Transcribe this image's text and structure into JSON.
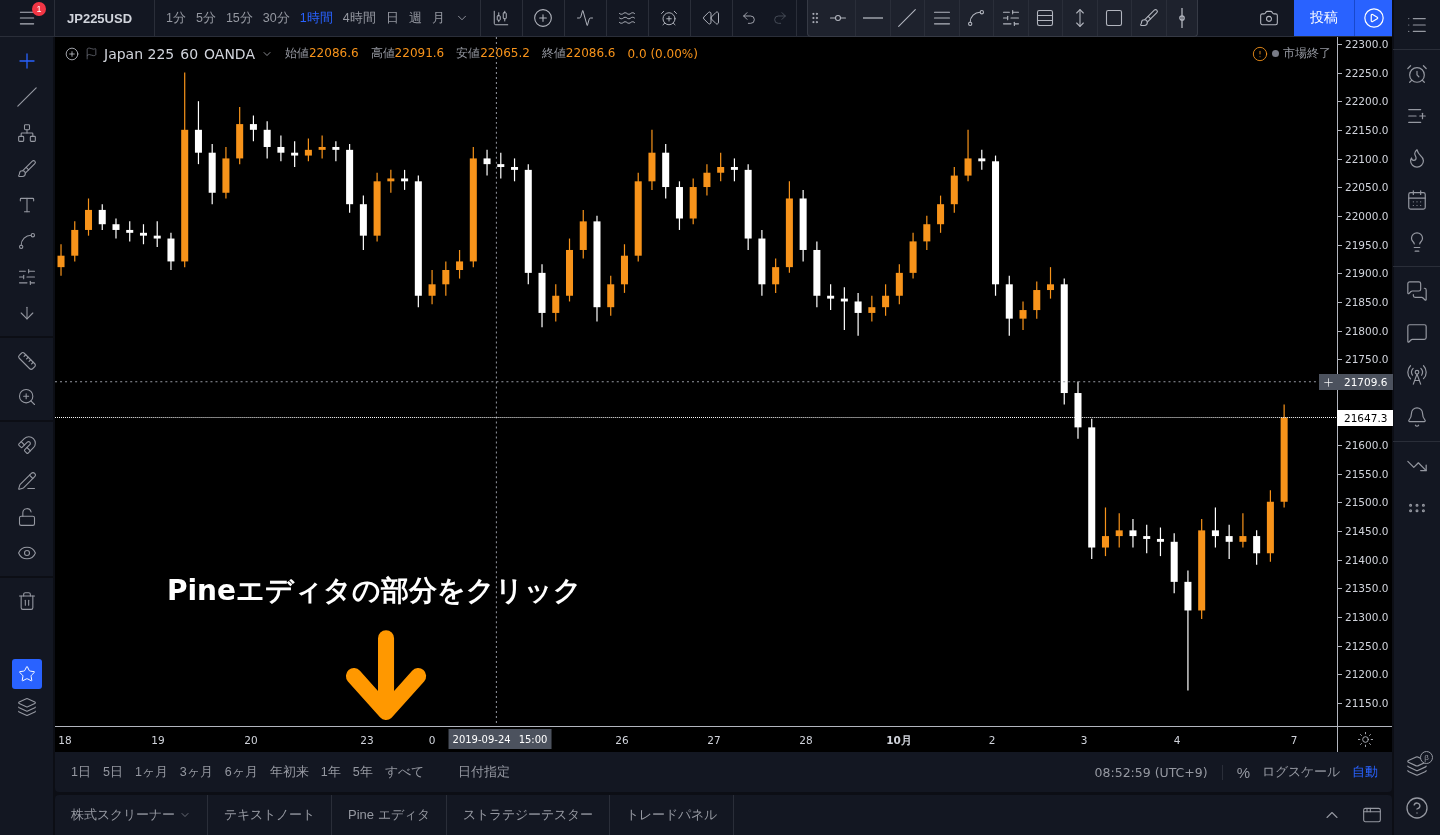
{
  "header": {
    "menu_badge": "1",
    "symbol": "JP225USD",
    "intervals": [
      {
        "label": "1分",
        "selected": false
      },
      {
        "label": "5分",
        "selected": false
      },
      {
        "label": "15分",
        "selected": false
      },
      {
        "label": "30分",
        "selected": false
      },
      {
        "label": "1時間",
        "selected": true
      },
      {
        "label": "4時間",
        "selected": false
      },
      {
        "label": "日",
        "selected": false
      },
      {
        "label": "週",
        "selected": false
      },
      {
        "label": "月",
        "selected": false
      }
    ],
    "publish_button": "投稿"
  },
  "legend": {
    "title": "Japan 225",
    "interval": "60",
    "source": "OANDA",
    "values": [
      {
        "label": "始値",
        "value": "22086.6"
      },
      {
        "label": "高値",
        "value": "22091.6"
      },
      {
        "label": "安値",
        "value": "22065.2"
      },
      {
        "label": "終値",
        "value": "22086.6"
      }
    ],
    "change": "0.0 (0.00%)",
    "market_status": "市場終了"
  },
  "price_axis": {
    "crosshair_price": "21709.6"
  },
  "time_axis": {
    "ticks": [
      {
        "label": "18",
        "kind": "day"
      },
      {
        "label": "19",
        "kind": "day"
      },
      {
        "label": "20",
        "kind": "day"
      },
      {
        "label": "23",
        "kind": "day"
      },
      {
        "label": "0",
        "kind": "day"
      },
      {
        "label": "26",
        "kind": "day"
      },
      {
        "label": "27",
        "kind": "day"
      },
      {
        "label": "28",
        "kind": "day"
      },
      {
        "label": "10月",
        "kind": "month"
      },
      {
        "label": "2",
        "kind": "day"
      },
      {
        "label": "3",
        "kind": "day"
      },
      {
        "label": "4",
        "kind": "day"
      },
      {
        "label": "7",
        "kind": "day"
      }
    ],
    "crosshair_date": "2019-09-24",
    "crosshair_time": "15:00"
  },
  "annotation": "Pineエディタの部分をクリック",
  "chart_data": {
    "type": "candlestick",
    "ylim": [
      21108.1,
      22312.2
    ],
    "ref_lines": [
      {
        "axis": "y",
        "value": 21647.3,
        "label": "21647.3"
      }
    ],
    "categories": [
      null,
      null,
      null,
      null,
      null,
      null,
      null,
      null,
      null,
      null,
      null,
      null,
      null,
      null,
      null,
      null,
      null,
      null,
      null,
      null,
      null,
      null,
      null,
      null,
      null,
      null,
      null,
      null,
      null,
      null,
      null,
      null,
      null,
      null,
      null,
      null,
      null,
      null,
      null,
      null,
      null,
      null,
      null,
      null,
      null,
      null,
      null,
      null,
      null,
      null,
      null,
      null,
      null,
      null,
      null,
      null,
      null,
      null,
      null,
      null,
      null,
      null,
      null,
      null,
      null,
      null,
      null,
      null,
      null,
      null,
      null,
      null,
      null,
      null,
      null,
      null,
      null,
      null,
      null,
      null,
      null,
      null,
      null,
      null,
      null,
      null,
      null,
      null,
      null,
      null
    ],
    "yticks": [
      {
        "value": 22300,
        "label": "22300.0"
      },
      {
        "value": 22250,
        "label": "22250.0"
      },
      {
        "value": 22200,
        "label": "22200.0"
      },
      {
        "value": 22150,
        "label": "22150.0"
      },
      {
        "value": 22100,
        "label": "22100.0"
      },
      {
        "value": 22050,
        "label": "22050.0"
      },
      {
        "value": 22000,
        "label": "22000.0"
      },
      {
        "value": 21950,
        "label": "21950.0"
      },
      {
        "value": 21900,
        "label": "21900.0"
      },
      {
        "value": 21850,
        "label": "21850.0"
      },
      {
        "value": 21800,
        "label": "21800.0"
      },
      {
        "value": 21750,
        "label": "21750.0"
      },
      {
        "value": 21600,
        "label": "21600.0"
      },
      {
        "value": 21550,
        "label": "21550.0"
      },
      {
        "value": 21500,
        "label": "21500.0"
      },
      {
        "value": 21450,
        "label": "21450.0"
      },
      {
        "value": 21400,
        "label": "21400.0"
      },
      {
        "value": 21350,
        "label": "21350.0"
      },
      {
        "value": 21300,
        "label": "21300.0"
      },
      {
        "value": 21250,
        "label": "21250.0"
      },
      {
        "value": 21200,
        "label": "21200.0"
      },
      {
        "value": 21150,
        "label": "21150.0"
      }
    ],
    "ohlc": [
      [
        21910,
        21950,
        21895,
        21930
      ],
      [
        21930,
        21990,
        21920,
        21975
      ],
      [
        21975,
        22030,
        21965,
        22010
      ],
      [
        22010,
        22020,
        21975,
        21985
      ],
      [
        21985,
        21995,
        21960,
        21975
      ],
      [
        21975,
        21990,
        21955,
        21970
      ],
      [
        21970,
        21985,
        21950,
        21965
      ],
      [
        21965,
        21990,
        21945,
        21960
      ],
      [
        21960,
        21970,
        21905,
        21920
      ],
      [
        21920,
        22250,
        21910,
        22150
      ],
      [
        22150,
        22200,
        22090,
        22110
      ],
      [
        22110,
        22125,
        22020,
        22040
      ],
      [
        22040,
        22120,
        22030,
        22100
      ],
      [
        22100,
        22190,
        22090,
        22160
      ],
      [
        22160,
        22175,
        22130,
        22150
      ],
      [
        22150,
        22165,
        22100,
        22120
      ],
      [
        22120,
        22140,
        22095,
        22110
      ],
      [
        22110,
        22130,
        22085,
        22105
      ],
      [
        22105,
        22135,
        22095,
        22115
      ],
      [
        22115,
        22140,
        22100,
        22120
      ],
      [
        22120,
        22130,
        22095,
        22115
      ],
      [
        22115,
        22125,
        22005,
        22020
      ],
      [
        22020,
        22035,
        21940,
        21965
      ],
      [
        21965,
        22075,
        21955,
        22060
      ],
      [
        22060,
        22080,
        22040,
        22065
      ],
      [
        22065,
        22080,
        22045,
        22060
      ],
      [
        22060,
        22070,
        21840,
        21860
      ],
      [
        21860,
        21905,
        21845,
        21880
      ],
      [
        21880,
        21920,
        21860,
        21905
      ],
      [
        21905,
        21940,
        21890,
        21920
      ],
      [
        21920,
        22120,
        21910,
        22100
      ],
      [
        22100,
        22115,
        22070,
        22090
      ],
      [
        22090,
        22110,
        22065,
        22085
      ],
      [
        22085,
        22100,
        22060,
        22080
      ],
      [
        22080,
        22090,
        21880,
        21900
      ],
      [
        21900,
        21915,
        21805,
        21830
      ],
      [
        21830,
        21880,
        21815,
        21860
      ],
      [
        21860,
        21960,
        21850,
        21940
      ],
      [
        21940,
        22010,
        21925,
        21990
      ],
      [
        21990,
        22000,
        21815,
        21840
      ],
      [
        21840,
        21895,
        21825,
        21880
      ],
      [
        21880,
        21950,
        21865,
        21930
      ],
      [
        21930,
        22075,
        21920,
        22060
      ],
      [
        22060,
        22150,
        22045,
        22110
      ],
      [
        22110,
        22125,
        22030,
        22050
      ],
      [
        22050,
        22060,
        21975,
        21995
      ],
      [
        21995,
        22065,
        21985,
        22050
      ],
      [
        22050,
        22090,
        22035,
        22075
      ],
      [
        22075,
        22110,
        22060,
        22085
      ],
      [
        22085,
        22100,
        22060,
        22080
      ],
      [
        22080,
        22090,
        21940,
        21960
      ],
      [
        21960,
        21975,
        21860,
        21880
      ],
      [
        21880,
        21925,
        21865,
        21910
      ],
      [
        21910,
        22060,
        21900,
        22030
      ],
      [
        22030,
        22045,
        21920,
        21940
      ],
      [
        21940,
        21955,
        21840,
        21860
      ],
      [
        21860,
        21880,
        21835,
        21855
      ],
      [
        21855,
        21875,
        21800,
        21850
      ],
      [
        21850,
        21865,
        21790,
        21830
      ],
      [
        21830,
        21860,
        21815,
        21840
      ],
      [
        21840,
        21880,
        21825,
        21860
      ],
      [
        21860,
        21915,
        21845,
        21900
      ],
      [
        21900,
        21970,
        21890,
        21955
      ],
      [
        21955,
        22000,
        21940,
        21985
      ],
      [
        21985,
        22035,
        21970,
        22020
      ],
      [
        22020,
        22085,
        22005,
        22070
      ],
      [
        22070,
        22150,
        22060,
        22100
      ],
      [
        22100,
        22115,
        22080,
        22095
      ],
      [
        22095,
        22105,
        21860,
        21880
      ],
      [
        21880,
        21895,
        21790,
        21820
      ],
      [
        21820,
        21850,
        21800,
        21835
      ],
      [
        21835,
        21885,
        21820,
        21870
      ],
      [
        21870,
        21910,
        21855,
        21880
      ],
      [
        21880,
        21890,
        21670,
        21690
      ],
      [
        21690,
        21710,
        21610,
        21630
      ],
      [
        21630,
        21645,
        21400,
        21420
      ],
      [
        21420,
        21490,
        21405,
        21440
      ],
      [
        21440,
        21480,
        21420,
        21450
      ],
      [
        21450,
        21470,
        21420,
        21440
      ],
      [
        21440,
        21460,
        21410,
        21435
      ],
      [
        21435,
        21455,
        21405,
        21430
      ],
      [
        21430,
        21445,
        21340,
        21360
      ],
      [
        21360,
        21380,
        21170,
        21310
      ],
      [
        21310,
        21470,
        21295,
        21450
      ],
      [
        21450,
        21490,
        21420,
        21440
      ],
      [
        21440,
        21460,
        21400,
        21430
      ],
      [
        21430,
        21480,
        21420,
        21440
      ],
      [
        21440,
        21450,
        21390,
        21410
      ],
      [
        21410,
        21520,
        21395,
        21500
      ],
      [
        21500,
        21670,
        21490,
        21647.3
      ]
    ]
  },
  "range_bar": {
    "ranges": [
      "1日",
      "5日",
      "1ヶ月",
      "3ヶ月",
      "6ヶ月",
      "年初来",
      "1年",
      "5年",
      "すべて"
    ],
    "date_range": "日付指定",
    "clock": "08:52:59 (UTC+9)",
    "percent": "%",
    "log_scale": "ログスケール",
    "auto_scale": {
      "label": "自動",
      "on": true
    }
  },
  "panel_tabs": [
    "株式スクリーナー",
    "テキストノート",
    "Pine エディタ",
    "ストラテジーテスター",
    "トレードパネル"
  ],
  "sidebar_badge": "β"
}
